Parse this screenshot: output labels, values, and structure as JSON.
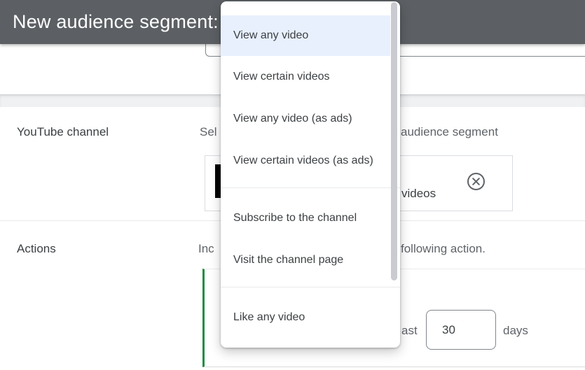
{
  "header": {
    "title": "New audience segment:"
  },
  "menu": {
    "selected_index": 0,
    "items": [
      {
        "label": "View any video"
      },
      {
        "label": "View certain videos"
      },
      {
        "label": "View any video (as ads)"
      },
      {
        "label": "View certain videos (as ads)"
      },
      {
        "label": "Subscribe to the channel"
      },
      {
        "label": "Visit the channel page"
      },
      {
        "label": "Like any video"
      }
    ]
  },
  "rows": {
    "youtube_channel": {
      "label": "YouTube channel",
      "desc_left_fragment": "Sel",
      "desc_right_fragment": "audience segment",
      "chip": {
        "text_fragment": "videos",
        "remove_icon": "circled-x-icon"
      }
    },
    "actions": {
      "label": "Actions",
      "desc_left_fragment": "Inc",
      "desc_right_fragment": "following action.",
      "lookback": {
        "text_before_fragment": "ast",
        "value": "30",
        "unit": "days"
      }
    }
  },
  "colors": {
    "header_bg": "#5c6064",
    "selected_item_bg": "#e8f0fe",
    "accent_green": "#1e8e3e",
    "text_primary": "#3c4043",
    "text_secondary": "#5f6368"
  }
}
